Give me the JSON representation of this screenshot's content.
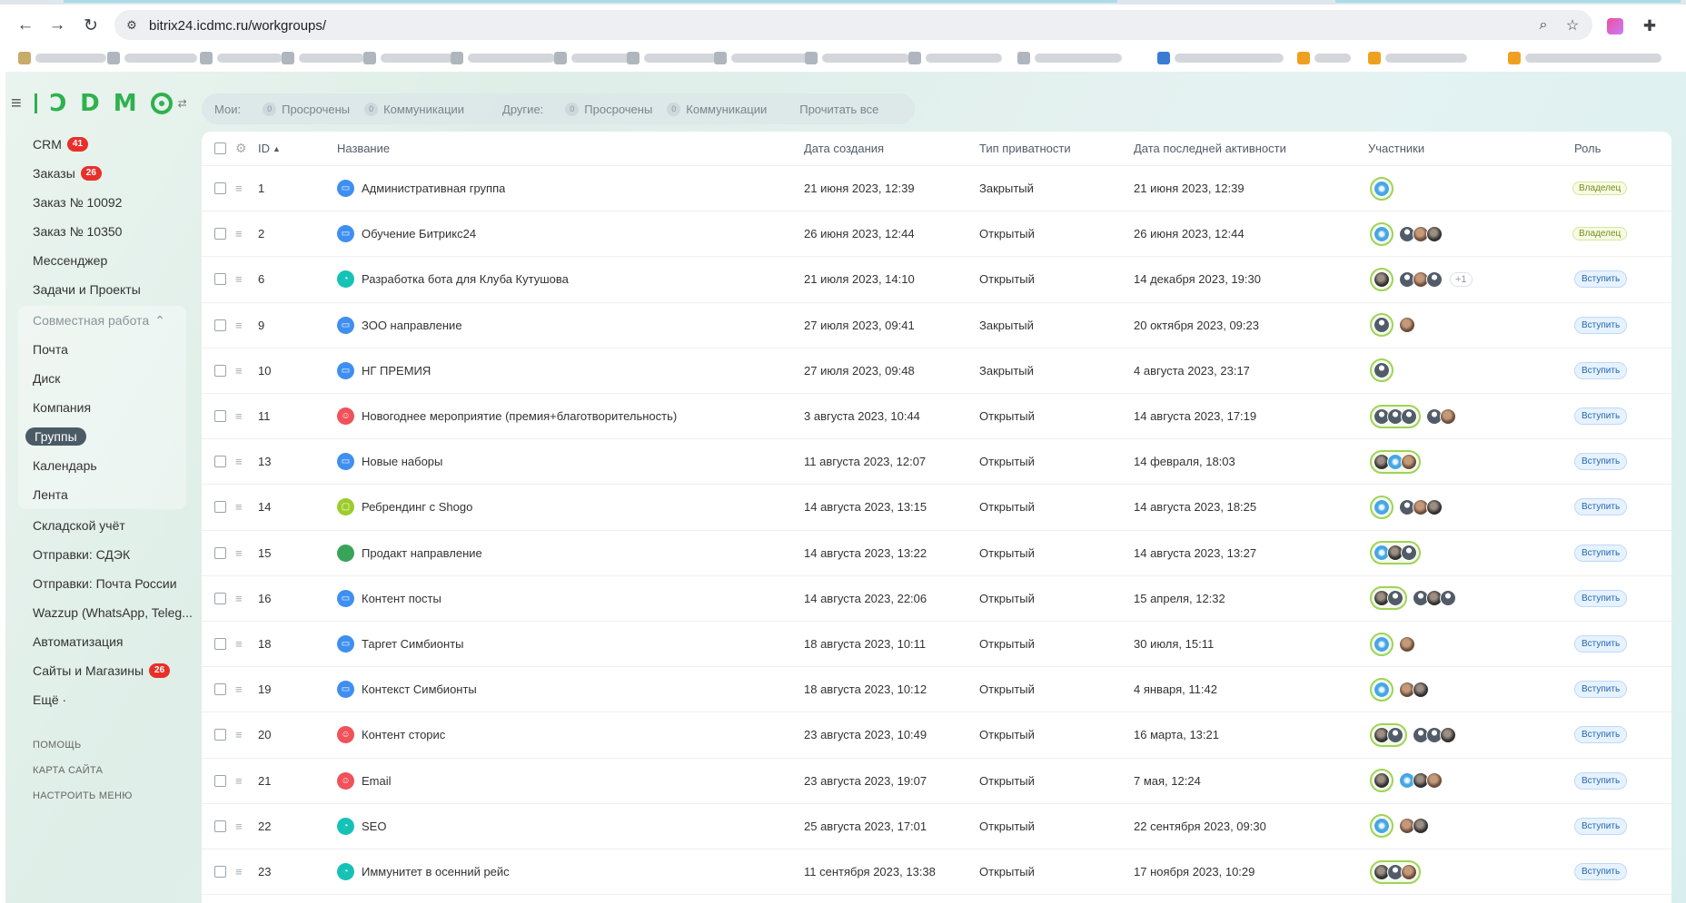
{
  "browser": {
    "url": "bitrix24.icdmc.ru/workgroups/",
    "back_icon": "←",
    "forward_icon": "→",
    "reload_icon": "↻",
    "site_info_icon": "⚙",
    "zoom_icon": "⌕",
    "star_icon": "☆",
    "extensions_icon": "✚"
  },
  "logo": {
    "burger": "≡",
    "letters": [
      "I",
      "Ͻ",
      "D",
      "M"
    ],
    "switch": "⇄"
  },
  "sidebar": {
    "items": [
      {
        "label": "CRM",
        "badge": "41"
      },
      {
        "label": "Заказы",
        "badge": "26"
      },
      {
        "label": "Заказ № 10092",
        "badge": ""
      },
      {
        "label": "Заказ № 10350",
        "badge": ""
      },
      {
        "label": "Мессенджер",
        "badge": ""
      },
      {
        "label": "Задачи и Проекты",
        "badge": ""
      }
    ],
    "group": {
      "title": "Совместная работа",
      "chevron": "⌃",
      "items": [
        "Почта",
        "Диск",
        "Компания",
        "Группы",
        "Календарь",
        "Лента"
      ],
      "active": "Группы"
    },
    "items2": [
      {
        "label": "Складской учёт",
        "badge": ""
      },
      {
        "label": "Отправки: СДЭК",
        "badge": ""
      },
      {
        "label": "Отправки: Почта России",
        "badge": ""
      },
      {
        "label": "Wazzup (WhatsApp, Teleg...",
        "badge": ""
      },
      {
        "label": "Автоматизация",
        "badge": ""
      },
      {
        "label": "Сайты и Магазины",
        "badge": "26"
      },
      {
        "label": "Ещё ·",
        "badge": ""
      }
    ],
    "footer": [
      "ПОМОЩЬ",
      "КАРТА САЙТА",
      "НАСТРОИТЬ МЕНЮ"
    ]
  },
  "filter": {
    "my_label": "Мои:",
    "my_overdue_count": "0",
    "my_overdue": "Просрочены",
    "my_comm_count": "0",
    "my_comm": "Коммуникации",
    "other_label": "Другие:",
    "other_overdue_count": "0",
    "other_overdue": "Просрочены",
    "other_comm_count": "0",
    "other_comm": "Коммуникации",
    "read_all": "Прочитать все"
  },
  "table": {
    "columns": {
      "settings_icon": "⚙",
      "id": "ID",
      "sort_icon": "▲",
      "name": "Название",
      "created": "Дата создания",
      "privacy": "Тип приватности",
      "activity": "Дата последней активности",
      "members": "Участники",
      "role": "Роль"
    },
    "drag_icon": "≡",
    "rows": [
      {
        "id": "1",
        "icon": "folder",
        "name": "Административная группа",
        "created": "21 июня 2023, 12:39",
        "privacy": "Закрытый",
        "activity": "21 июня 2023, 12:39",
        "owners": [
          "blue"
        ],
        "others": [],
        "plus": "",
        "role": "Владелец",
        "role_type": "owner"
      },
      {
        "id": "2",
        "icon": "folder",
        "name": "Обучение Битрикс24",
        "created": "26 июня 2023, 12:44",
        "privacy": "Открытый",
        "activity": "26 июня 2023, 12:44",
        "owners": [
          "blue"
        ],
        "others": [
          "user",
          "photo",
          "dark"
        ],
        "plus": "",
        "role": "Владелец",
        "role_type": "owner"
      },
      {
        "id": "6",
        "icon": "chart",
        "name": "Разработка бота для Клуба Кутушова",
        "created": "21 июля 2023, 14:10",
        "privacy": "Открытый",
        "activity": "14 декабря 2023, 19:30",
        "owners": [
          "dark"
        ],
        "others": [
          "user",
          "photo",
          "user"
        ],
        "plus": "+1",
        "role": "Вступить",
        "role_type": "join"
      },
      {
        "id": "9",
        "icon": "folder",
        "name": "ЗОО направление",
        "created": "27 июля 2023, 09:41",
        "privacy": "Закрытый",
        "activity": "20 октября 2023, 09:23",
        "owners": [
          "user"
        ],
        "others": [
          "photo"
        ],
        "plus": "",
        "role": "Вступить",
        "role_type": "join"
      },
      {
        "id": "10",
        "icon": "folder",
        "name": "НГ ПРЕМИЯ",
        "created": "27 июля 2023, 09:48",
        "privacy": "Закрытый",
        "activity": "4 августа 2023, 23:17",
        "owners": [
          "user"
        ],
        "others": [],
        "plus": "",
        "role": "Вступить",
        "role_type": "join"
      },
      {
        "id": "11",
        "icon": "people",
        "name": "Новогоднее мероприятие (премия+благотворительность)",
        "created": "3 августа 2023, 10:44",
        "privacy": "Открытый",
        "activity": "14 августа 2023, 17:19",
        "owners": [
          "user",
          "user",
          "user"
        ],
        "others": [
          "user",
          "photo"
        ],
        "plus": "",
        "role": "Вступить",
        "role_type": "join"
      },
      {
        "id": "13",
        "icon": "folder",
        "name": "Новые наборы",
        "created": "11 августа 2023, 12:07",
        "privacy": "Открытый",
        "activity": "14 февраля, 18:03",
        "owners": [
          "dark",
          "blue",
          "photo"
        ],
        "others": [],
        "plus": "",
        "role": "Вступить",
        "role_type": "join"
      },
      {
        "id": "14",
        "icon": "chat",
        "name": "Ребрендинг с Shogo",
        "created": "14 августа 2023, 13:15",
        "privacy": "Открытый",
        "activity": "14 августа 2023, 18:25",
        "owners": [
          "blue"
        ],
        "others": [
          "user",
          "photo",
          "dark"
        ],
        "plus": "",
        "role": "Вступить",
        "role_type": "join"
      },
      {
        "id": "15",
        "icon": "dot",
        "name": "Продакт направление",
        "created": "14 августа 2023, 13:22",
        "privacy": "Открытый",
        "activity": "14 августа 2023, 13:27",
        "owners": [
          "blue",
          "dark",
          "user"
        ],
        "others": [],
        "plus": "",
        "role": "Вступить",
        "role_type": "join"
      },
      {
        "id": "16",
        "icon": "folder",
        "name": "Контент посты",
        "created": "14 августа 2023, 22:06",
        "privacy": "Открытый",
        "activity": "15 апреля, 12:32",
        "owners": [
          "dark",
          "user"
        ],
        "others": [
          "user",
          "dark",
          "user"
        ],
        "plus": "",
        "role": "Вступить",
        "role_type": "join"
      },
      {
        "id": "18",
        "icon": "folder",
        "name": "Таргет Симбионты",
        "created": "18 августа 2023, 10:11",
        "privacy": "Открытый",
        "activity": "30 июля, 15:11",
        "owners": [
          "blue"
        ],
        "others": [
          "photo"
        ],
        "plus": "",
        "role": "Вступить",
        "role_type": "join"
      },
      {
        "id": "19",
        "icon": "folder",
        "name": "Контекст Симбионты",
        "created": "18 августа 2023, 10:12",
        "privacy": "Открытый",
        "activity": "4 января, 11:42",
        "owners": [
          "blue"
        ],
        "others": [
          "photo",
          "dark"
        ],
        "plus": "",
        "role": "Вступить",
        "role_type": "join"
      },
      {
        "id": "20",
        "icon": "people",
        "name": "Контент сторис",
        "created": "23 августа 2023, 10:49",
        "privacy": "Открытый",
        "activity": "16 марта, 13:21",
        "owners": [
          "dark",
          "user"
        ],
        "others": [
          "user",
          "user",
          "dark"
        ],
        "plus": "",
        "role": "Вступить",
        "role_type": "join"
      },
      {
        "id": "21",
        "icon": "people",
        "name": "Email",
        "created": "23 августа 2023, 19:07",
        "privacy": "Открытый",
        "activity": "7 мая, 12:24",
        "owners": [
          "dark"
        ],
        "others": [
          "blue",
          "dark",
          "photo"
        ],
        "plus": "",
        "role": "Вступить",
        "role_type": "join"
      },
      {
        "id": "22",
        "icon": "chart",
        "name": "SEO",
        "created": "25 августа 2023, 17:01",
        "privacy": "Открытый",
        "activity": "22 сентября 2023, 09:30",
        "owners": [
          "blue"
        ],
        "others": [
          "photo",
          "dark"
        ],
        "plus": "",
        "role": "Вступить",
        "role_type": "join"
      },
      {
        "id": "23",
        "icon": "chart",
        "name": "Иммунитет в осенний рейс",
        "created": "11 сентября 2023, 13:38",
        "privacy": "Открытый",
        "activity": "17 ноября 2023, 10:29",
        "owners": [
          "dark",
          "user",
          "photo"
        ],
        "others": [],
        "plus": "",
        "role": "Вступить",
        "role_type": "join"
      }
    ]
  }
}
